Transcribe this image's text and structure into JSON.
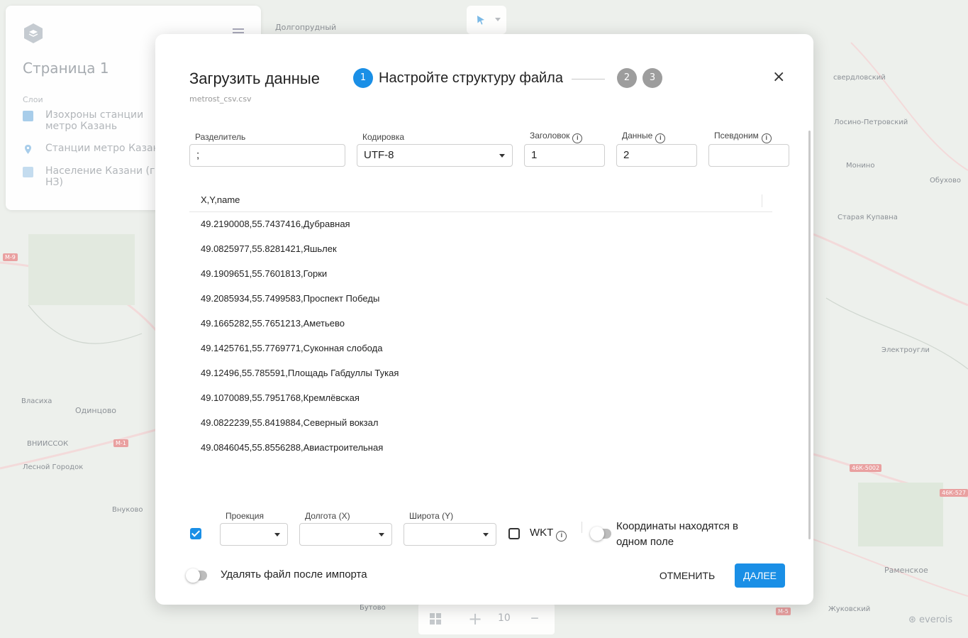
{
  "map": {
    "labels": {
      "dolgoprudny": "Долгопрудный",
      "losino": "Лосино-Петровский",
      "monino": "Монино",
      "obukhovo": "Обухово",
      "staraya_kupavna": "Старая Купавна",
      "elektrougli": "Электроугли",
      "odintsovo": "Одинцово",
      "vlasikha": "Власиха",
      "vnissosk": "ВНИИССОК",
      "lesnoy_gorodok": "Лесной Городок",
      "vnukovo": "Внуково",
      "ramenskoe": "Раменское",
      "butovo": "Бутово",
      "zhukovsky": "Жуковский",
      "sverdlovsky": "свердловский",
      "m9": "М-9",
      "m1": "М-1",
      "r46k5002": "46К-5002",
      "r46k5270": "46К-527",
      "m5": "М-5"
    }
  },
  "left_panel": {
    "title": "Страница 1",
    "section": "Слои",
    "layers": [
      {
        "label": "Изохроны станции метро Казань",
        "color": "#a8cdea"
      },
      {
        "label": "Станции метро Казани",
        "color": "#a8cdea"
      },
      {
        "label": "Население Казани (гекс НЗ)",
        "color": "#c4dcef"
      }
    ]
  },
  "zoom": {
    "value": "10"
  },
  "brand": "everois",
  "modal": {
    "title": "Загрузить данные",
    "file_name": "metrost_csv.csv",
    "steps": {
      "current_num": "1",
      "current_label": "Настройте структуру файла",
      "step2": "2",
      "step3": "3"
    },
    "close_glyph": "×",
    "fields": {
      "separator": {
        "label": "Разделитель",
        "value": ";"
      },
      "encoding": {
        "label": "Кодировка",
        "value": "UTF-8"
      },
      "header": {
        "label": "Заголовок",
        "value": "1"
      },
      "data": {
        "label": "Данные",
        "value": "2"
      },
      "alias": {
        "label": "Псевдоним",
        "value": ""
      }
    },
    "table": {
      "header": "X,Y,name",
      "rows": [
        "49.2190008,55.7437416,Дубравная",
        "49.0825977,55.8281421,Яшьлек",
        "49.1909651,55.7601813,Горки",
        "49.2085934,55.7499583,Проспект Победы",
        "49.1665282,55.7651213,Аметьево",
        "49.1425761,55.7769771,Суконная слобода",
        "49.12496,55.785591,Площадь Габдуллы Тукая",
        "49.1070089,55.7951768,Кремлёвская",
        "49.0822239,55.8419884,Северный вокзал",
        "49.0846045,55.8556288,Авиастроительная"
      ]
    },
    "geo": {
      "projection_label": "Проекция",
      "longitude_label": "Долгота (X)",
      "latitude_label": "Широта (Y)",
      "wkt_label": "WKT",
      "single_field_label_1": "Координаты находятся в",
      "single_field_label_2": "одном поле"
    },
    "delete_after_import": "Удалять файл после импорта",
    "cancel": "ОТМЕНИТЬ",
    "next": "ДАЛЕЕ"
  }
}
